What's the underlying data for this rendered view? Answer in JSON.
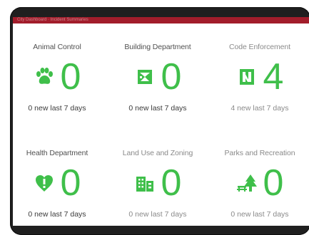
{
  "header": {
    "title": "City Dashboard · Incident Summaries"
  },
  "colors": {
    "accent_green": "#3fbf4a",
    "header_red": "#a21d2b",
    "device_frame": "#1f1f1f"
  },
  "tiles": [
    {
      "title": "Animal Control",
      "icon": "paw-icon",
      "count": "0",
      "subtitle": "0 new last 7 days"
    },
    {
      "title": "Building Department",
      "icon": "building-permit-icon",
      "count": "0",
      "subtitle": "0 new last 7 days"
    },
    {
      "title": "Code Enforcement",
      "icon": "code-enforcement-icon",
      "count": "4",
      "subtitle": "4 new last 7 days"
    },
    {
      "title": "Health Department",
      "icon": "heart-alert-icon",
      "count": "0",
      "subtitle": "0 new last 7 days"
    },
    {
      "title": "Land Use and Zoning",
      "icon": "city-buildings-icon",
      "count": "0",
      "subtitle": "0 new last 7 days"
    },
    {
      "title": "Parks and Recreation",
      "icon": "park-tree-bench-icon",
      "count": "0",
      "subtitle": "0 new last 7 days"
    }
  ]
}
